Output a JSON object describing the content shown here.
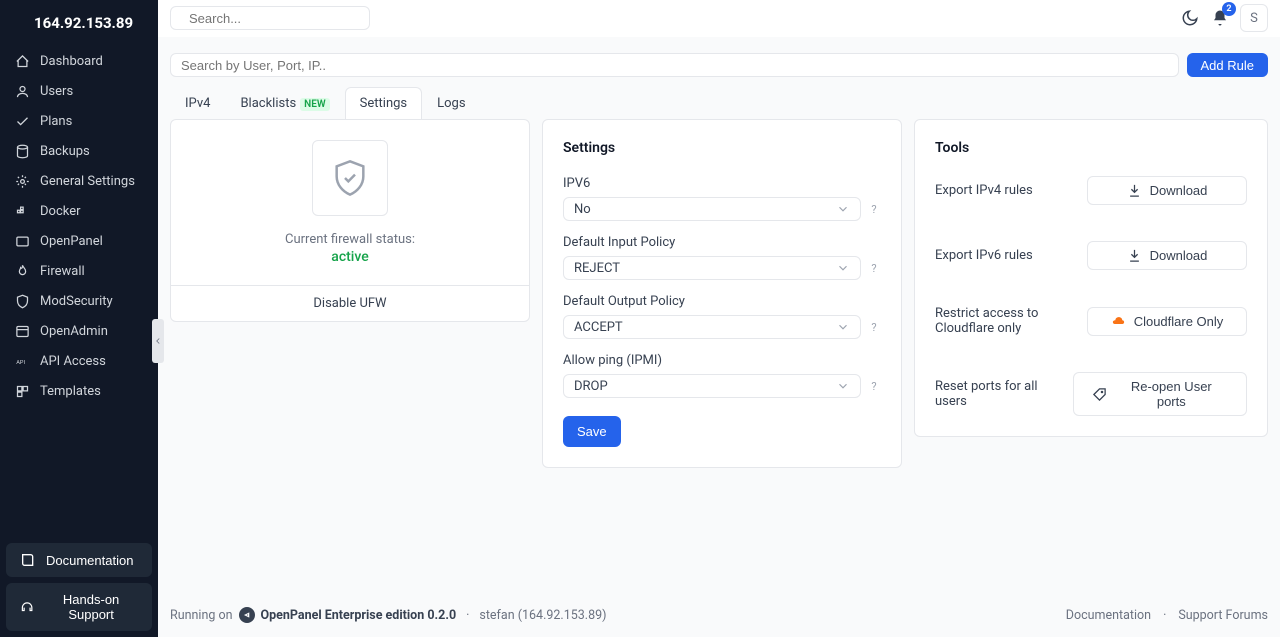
{
  "header": {
    "ip": "164.92.153.89",
    "search_placeholder": "Search...",
    "notif_count": "2",
    "avatar_letter": "S"
  },
  "sidebar": {
    "items": [
      {
        "label": "Dashboard"
      },
      {
        "label": "Users"
      },
      {
        "label": "Plans"
      },
      {
        "label": "Backups"
      },
      {
        "label": "General Settings"
      },
      {
        "label": "Docker"
      },
      {
        "label": "OpenPanel"
      },
      {
        "label": "Firewall"
      },
      {
        "label": "ModSecurity"
      },
      {
        "label": "OpenAdmin"
      },
      {
        "label": "API Access"
      },
      {
        "label": "Templates"
      }
    ],
    "bottom": {
      "documentation": "Documentation",
      "support": "Hands-on Support"
    }
  },
  "firewall": {
    "search_placeholder": "Search by User, Port, IP..",
    "add_rule": "Add Rule",
    "tabs": {
      "ipv4": "IPv4",
      "blacklists": "Blacklists",
      "blacklists_badge": "NEW",
      "settings": "Settings",
      "logs": "Logs"
    },
    "status": {
      "label": "Current firewall status:",
      "value": "active",
      "disable": "Disable UFW"
    },
    "settings": {
      "title": "Settings",
      "ipv6_label": "IPV6",
      "ipv6_value": "No",
      "input_policy_label": "Default Input Policy",
      "input_policy_value": "REJECT",
      "output_policy_label": "Default Output Policy",
      "output_policy_value": "ACCEPT",
      "ping_label": "Allow ping (IPMI)",
      "ping_value": "DROP",
      "save": "Save"
    },
    "tools": {
      "title": "Tools",
      "export_ipv4": "Export IPv4 rules",
      "export_ipv6": "Export IPv6 rules",
      "download": "Download",
      "cloudflare_label": "Restrict access to Cloudflare only",
      "cloudflare_btn": "Cloudflare Only",
      "reset_label": "Reset ports for all users",
      "reset_btn": "Re-open User ports"
    }
  },
  "footer": {
    "running": "Running on",
    "product": "OpenPanel Enterprise edition 0.2.0",
    "user": "stefan (164.92.153.89)",
    "docs": "Documentation",
    "forums": "Support Forums"
  }
}
